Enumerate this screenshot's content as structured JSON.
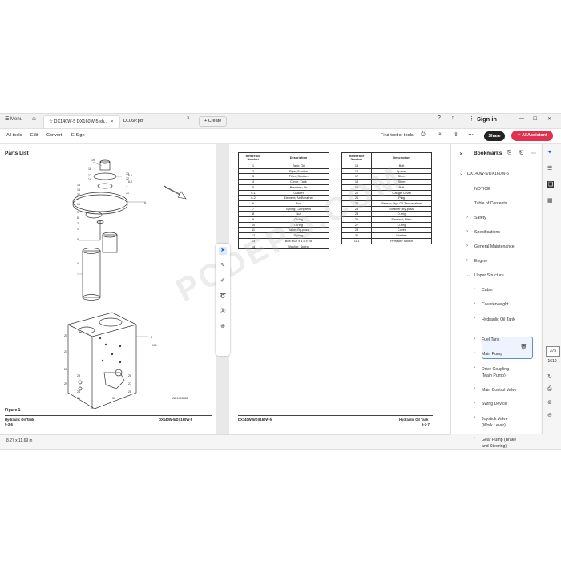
{
  "titlebar": {
    "menu_label": "Menu",
    "tabs": [
      {
        "label": "DX140W-5 DX160W-5 sh..."
      },
      {
        "label": "DL06P.pdf"
      }
    ],
    "create_label": "Create",
    "signin_label": "Sign in"
  },
  "toolbar": {
    "items": [
      "All tools",
      "Edit",
      "Convert",
      "E-Sign"
    ],
    "find_label": "Find text or tools",
    "share_label": "Share",
    "ai_label": "AI Assistant"
  },
  "page_left": {
    "title": "Parts List",
    "figure_label": "Figure 1",
    "drawing_code": "WE1403585",
    "footer_left": "Hydraulic Oil Tank",
    "footer_page": "5-3-6",
    "footer_right": "DX140W-5/DX160W-5",
    "callouts": [
      "19",
      "18",
      "17",
      "16",
      "15",
      "14",
      "13",
      "12",
      "11",
      "10",
      "9",
      "8",
      "7",
      "6",
      "5",
      "4",
      "3",
      "2",
      "1",
      "20",
      "21",
      "22",
      "23",
      "24",
      "25",
      "26",
      "27",
      "28",
      "29",
      "30",
      "31",
      "32",
      "6-1",
      "6-2",
      "101"
    ]
  },
  "page_right": {
    "footer_left": "DX140W-5/DX160W-5",
    "footer_right": "Hydraulic Oil Tank",
    "footer_page": "5-3-7",
    "table_headers": [
      "Reference Number",
      "Description"
    ],
    "table1": [
      [
        "1",
        "Tank; Oil"
      ],
      [
        "2",
        "Pipe; Suction"
      ],
      [
        "3",
        "Filter; Suction"
      ],
      [
        "4",
        "Cover; Tank"
      ],
      [
        "5",
        "Breather; Air"
      ],
      [
        "6-1",
        "Gasket"
      ],
      [
        "6-2",
        "Element; Air Breather"
      ],
      [
        "6",
        "Rod"
      ],
      [
        "7",
        "Spring; Compress"
      ],
      [
        "8",
        "Nut"
      ],
      [
        "9",
        "O-ring"
      ],
      [
        "10",
        "O-ring"
      ],
      [
        "11",
        "Valve; By-pass"
      ],
      [
        "12",
        "Spring"
      ],
      [
        "13",
        "Bolt M10 x 1.5 x 25"
      ],
      [
        "14",
        "Washer; Spring"
      ]
    ],
    "table2": [
      [
        "15",
        "Bolt"
      ],
      [
        "16",
        "Spacer"
      ],
      [
        "17",
        "Shim"
      ],
      [
        "18",
        "Shim"
      ],
      [
        "19",
        "Bolt"
      ],
      [
        "20",
        "Gauge; Level"
      ],
      [
        "21",
        "Plug"
      ],
      [
        "22",
        "Sensor; Hyd Oil Temperature"
      ],
      [
        "23",
        "Strainer; By-pass"
      ],
      [
        "24",
        "O-ring"
      ],
      [
        "25",
        "Element; Filter"
      ],
      [
        "27",
        "O-ring"
      ],
      [
        "28",
        "Cover"
      ],
      [
        "30",
        "Washer"
      ],
      [
        "101",
        "Pressure Switch"
      ]
    ]
  },
  "statusbar": {
    "size": "8.27 x 11.69 in"
  },
  "bookmarks": {
    "header": "Bookmarks",
    "items": [
      {
        "label": "DX140W-5/DX160W-5",
        "expanded": true
      },
      {
        "label": "NOTICE"
      },
      {
        "label": "Table of Contents"
      },
      {
        "label": "Safety"
      },
      {
        "label": "Specifications"
      },
      {
        "label": "General Maintenance"
      },
      {
        "label": "Engine"
      },
      {
        "label": "Upper Structure",
        "expanded": true
      },
      {
        "label": "Cabin"
      },
      {
        "label": "Counterweight"
      },
      {
        "label": "Hydraulic Oil Tank",
        "selected": true
      },
      {
        "label": "Fuel Tank"
      },
      {
        "label": "Main Pump"
      },
      {
        "label": "Drive Coupling (Main Pump)"
      },
      {
        "label": "Main Control Valve"
      },
      {
        "label": "Swing Device"
      },
      {
        "label": "Joystick Valve (Work Lever)"
      },
      {
        "label": "Gear Pump (Brake and Steering)"
      }
    ]
  },
  "rail": {
    "current_page": "375",
    "total_pages": "1610"
  },
  "watermark": "PCDEPO.COM",
  "colors": {
    "ai_button": "#e3304e",
    "share_button": "#222222",
    "selection": "#5a8be0"
  }
}
